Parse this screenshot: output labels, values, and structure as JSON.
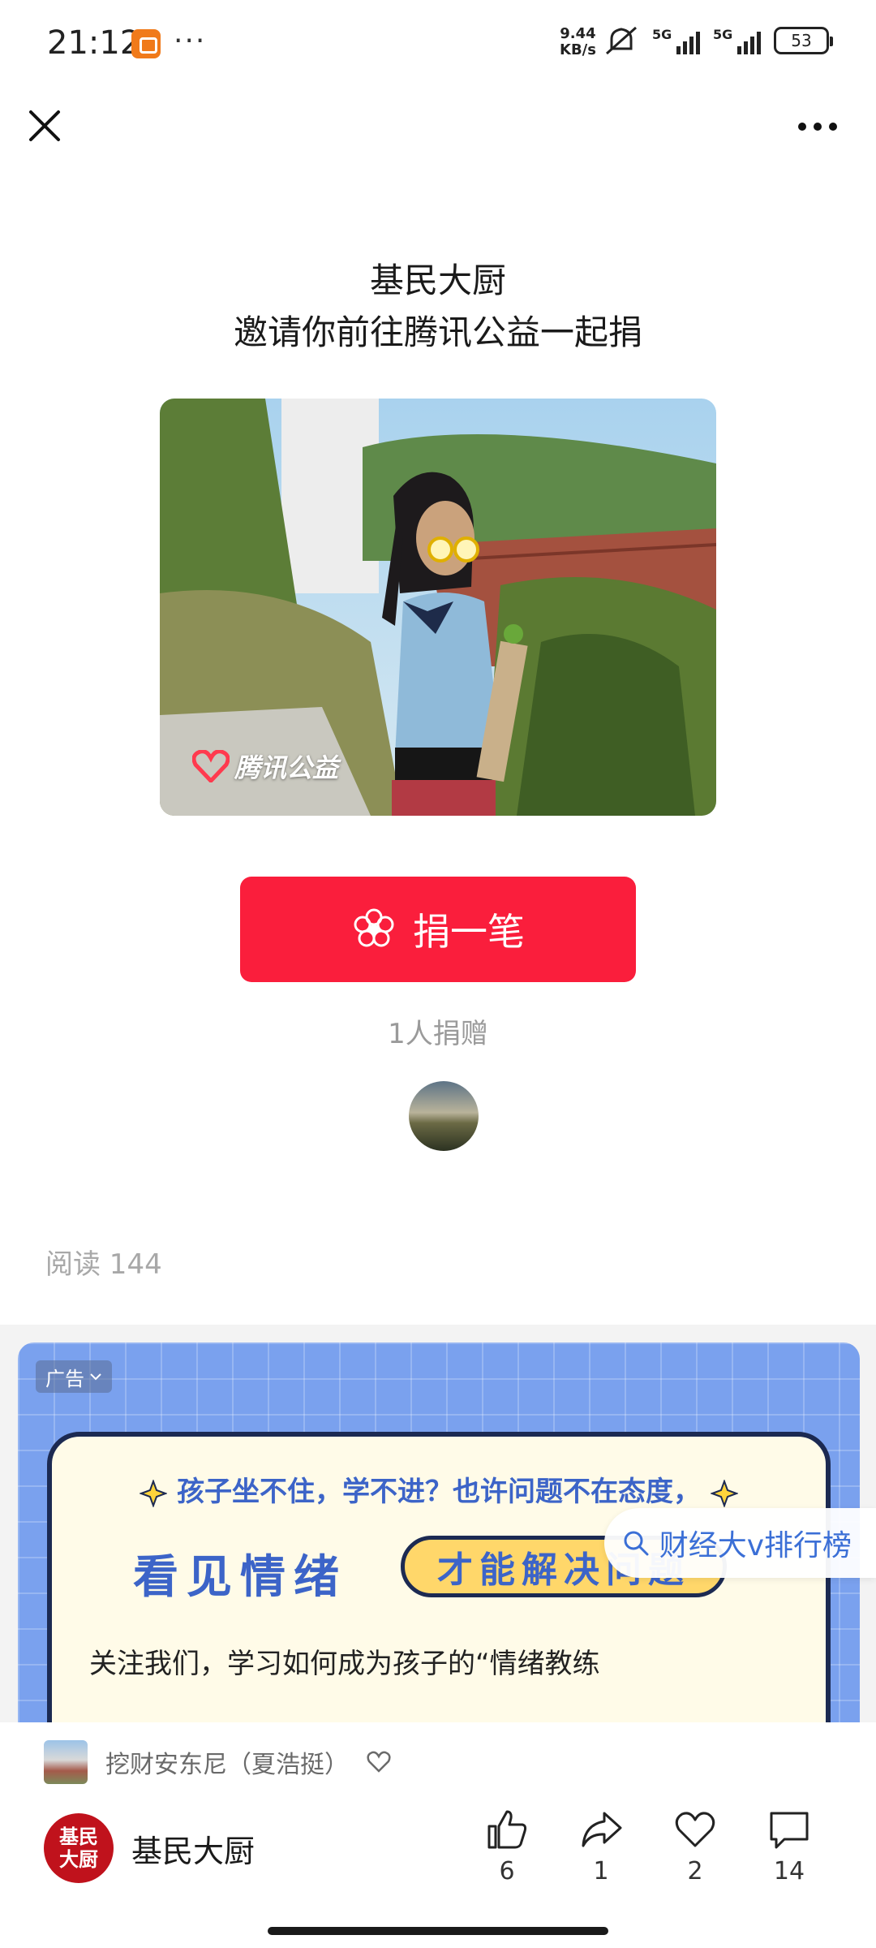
{
  "status_bar": {
    "time": "21:12",
    "net_speed_value": "9.44",
    "net_speed_unit": "KB/s",
    "signal1": "5G",
    "signal2": "5G",
    "battery": "53"
  },
  "invite": {
    "name": "基民大厨",
    "text": "邀请你前往腾讯公益一起捐"
  },
  "project": {
    "brand_label": "腾讯公益"
  },
  "donate": {
    "button_label": "捐一笔",
    "donor_count": "1人捐赠"
  },
  "article": {
    "read_count": "阅读 144"
  },
  "ad": {
    "tag": "广告",
    "line1": "孩子坐不住，学不进？也许问题不在态度，",
    "line2": "看见情绪",
    "pill": "才能解决问题",
    "line3": "关注我们，学习如何成为孩子的“情绪教练"
  },
  "search_chip": {
    "label": "财经大v排行榜"
  },
  "bottom": {
    "topic": "挖财安东尼（夏浩挺）",
    "author_avatar_text": "基民大厨",
    "author_name": "基民大厨",
    "actions": {
      "like": "6",
      "share": "1",
      "favorite": "2",
      "comment": "14"
    }
  },
  "colors": {
    "donate_red": "#fa1e3c",
    "ad_blue": "#7aa1ee",
    "link_blue": "#3b6fd6"
  }
}
